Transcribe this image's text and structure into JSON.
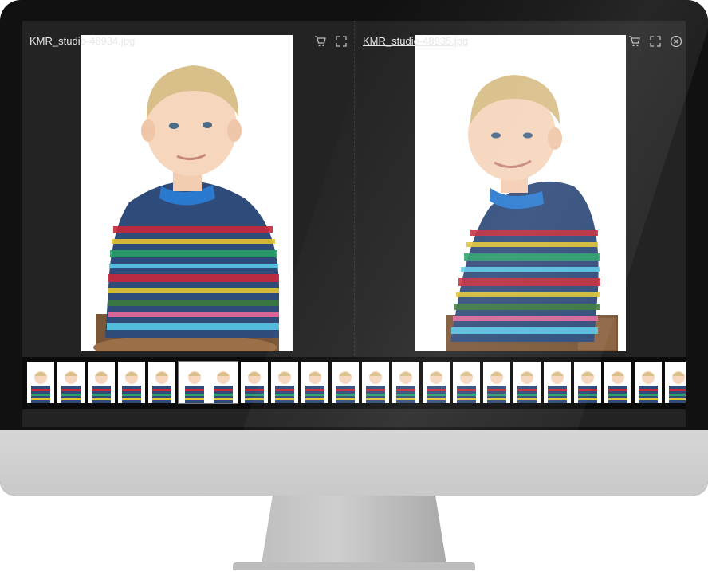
{
  "viewer": {
    "left_pane": {
      "filename": "KMR_studio-48934.jpg"
    },
    "right_pane": {
      "filename": "KMR_studio-48935.jpg"
    }
  },
  "icons": {
    "cart": "cart-icon",
    "fullscreen": "fullscreen-icon",
    "close": "close-circle-icon"
  },
  "filmstrip": {
    "thumb_count": 21,
    "selected_index": 5
  },
  "colors": {
    "screen_bg": "#232323",
    "filmstrip_bg": "#0b0b0b",
    "text": "#e8e8e8"
  }
}
